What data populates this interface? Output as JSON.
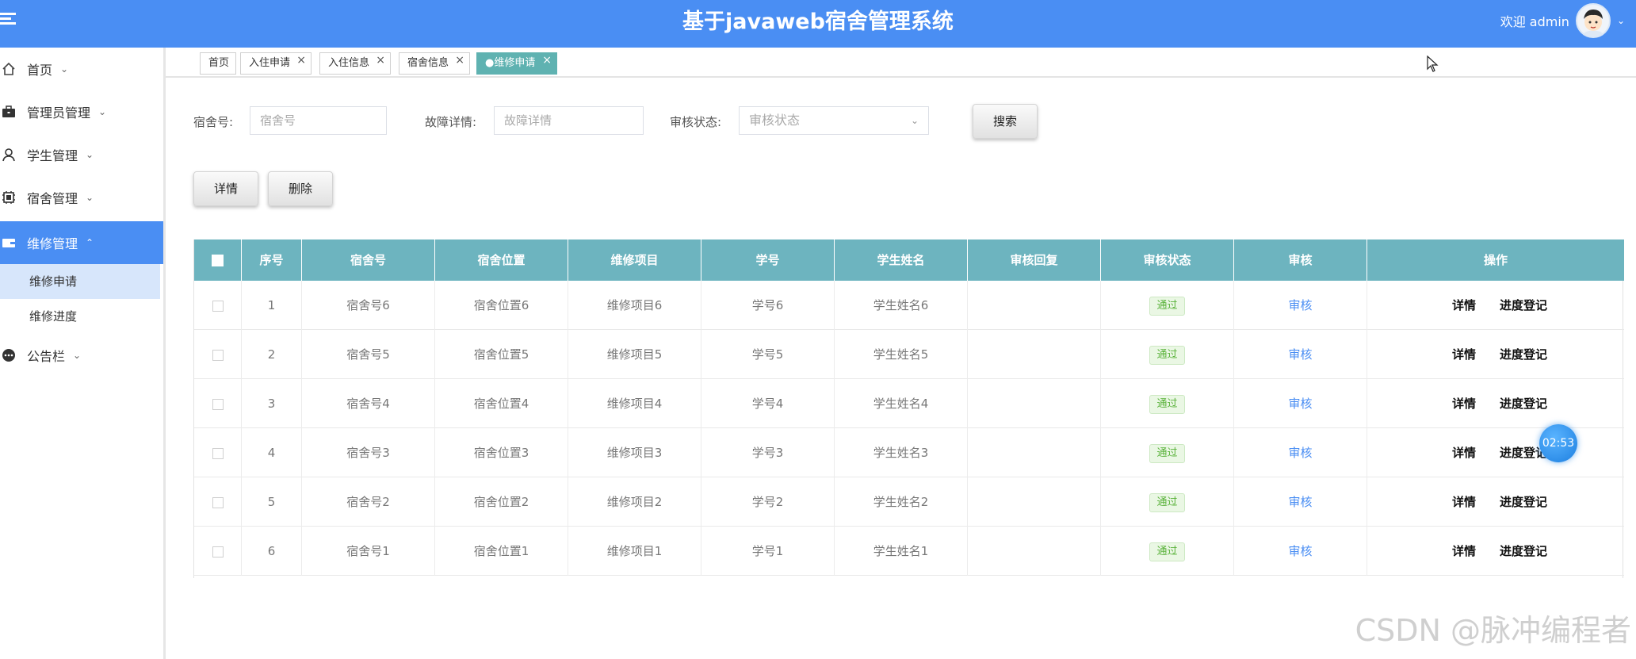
{
  "header": {
    "title": "基于javaweb宿舍管理系统",
    "welcome": "欢迎 admin"
  },
  "sidebar": {
    "items": [
      {
        "label": "首页",
        "icon": "home-icon"
      },
      {
        "label": "管理员管理",
        "icon": "briefcase-icon"
      },
      {
        "label": "学生管理",
        "icon": "person-icon"
      },
      {
        "label": "宿舍管理",
        "icon": "chip-icon"
      },
      {
        "label": "维修管理",
        "icon": "wallet-icon",
        "active": true
      },
      {
        "label": "公告栏",
        "icon": "ellipsis-circle-icon"
      }
    ],
    "subitems": [
      {
        "label": "维修申请",
        "selected": true
      },
      {
        "label": "维修进度"
      }
    ]
  },
  "tabs": [
    {
      "label": "首页"
    },
    {
      "label": "入住申请"
    },
    {
      "label": "入住信息"
    },
    {
      "label": "宿舍信息"
    },
    {
      "label": "●维修申请",
      "active": true
    }
  ],
  "search": {
    "dorm_label": "宿舍号:",
    "dorm_placeholder": "宿舍号",
    "fault_label": "故障详情:",
    "fault_placeholder": "故障详情",
    "status_label": "审核状态:",
    "status_placeholder": "审核状态",
    "search_button": "搜索"
  },
  "actions": {
    "detail_button": "详情",
    "delete_button": "删除"
  },
  "table": {
    "columns": [
      "序号",
      "宿舍号",
      "宿舍位置",
      "维修项目",
      "学号",
      "学生姓名",
      "审核回复",
      "审核状态",
      "审核",
      "操作"
    ],
    "rows": [
      {
        "no": "1",
        "dorm": "宿舍号6",
        "location": "宿舍位置6",
        "item": "维修项目6",
        "student_id": "学号6",
        "name": "学生姓名6",
        "reply": "",
        "status": "通过",
        "audit": "审核",
        "op_detail": "详情",
        "op_progress": "进度登记"
      },
      {
        "no": "2",
        "dorm": "宿舍号5",
        "location": "宿舍位置5",
        "item": "维修项目5",
        "student_id": "学号5",
        "name": "学生姓名5",
        "reply": "",
        "status": "通过",
        "audit": "审核",
        "op_detail": "详情",
        "op_progress": "进度登记"
      },
      {
        "no": "3",
        "dorm": "宿舍号4",
        "location": "宿舍位置4",
        "item": "维修项目4",
        "student_id": "学号4",
        "name": "学生姓名4",
        "reply": "",
        "status": "通过",
        "audit": "审核",
        "op_detail": "详情",
        "op_progress": "进度登记"
      },
      {
        "no": "4",
        "dorm": "宿舍号3",
        "location": "宿舍位置3",
        "item": "维修项目3",
        "student_id": "学号3",
        "name": "学生姓名3",
        "reply": "",
        "status": "通过",
        "audit": "审核",
        "op_detail": "详情",
        "op_progress": "进度登记"
      },
      {
        "no": "5",
        "dorm": "宿舍号2",
        "location": "宿舍位置2",
        "item": "维修项目2",
        "student_id": "学号2",
        "name": "学生姓名2",
        "reply": "",
        "status": "通过",
        "audit": "审核",
        "op_detail": "详情",
        "op_progress": "进度登记"
      },
      {
        "no": "6",
        "dorm": "宿舍号1",
        "location": "宿舍位置1",
        "item": "维修项目1",
        "student_id": "学号1",
        "name": "学生姓名1",
        "reply": "",
        "status": "通过",
        "audit": "审核",
        "op_detail": "详情",
        "op_progress": "进度登记"
      }
    ]
  },
  "timer": "02:53",
  "watermark": "CSDN @脉冲编程者",
  "colors": {
    "header": "#4a8ef3",
    "table_header": "#6db4bf",
    "active_tab": "#5fb2b1",
    "status_badge": "#59b23a",
    "audit_link": "#4a8ef3"
  }
}
